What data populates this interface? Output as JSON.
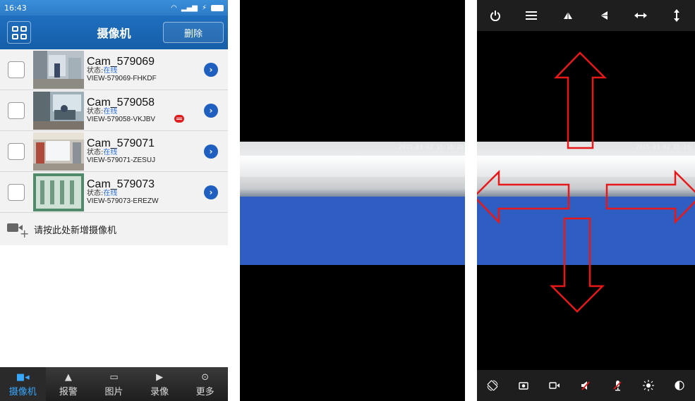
{
  "camera_list": {
    "status_bar": {
      "time": "16:43"
    },
    "header": {
      "title": "摄像机",
      "delete_label": "删除"
    },
    "cameras": [
      {
        "name": "Cam_579069",
        "status_label": "状态:",
        "status_value": "在线",
        "id": "VIEW-579069-FHKDF",
        "has_message": false
      },
      {
        "name": "Cam_579058",
        "status_label": "状态:",
        "status_value": "在线",
        "id": "VIEW-579058-VKJBV",
        "has_message": true
      },
      {
        "name": "Cam_579071",
        "status_label": "状态:",
        "status_value": "在线",
        "id": "VIEW-579071-ZESUJ",
        "has_message": false
      },
      {
        "name": "Cam_579073",
        "status_label": "状态:",
        "status_value": "在线",
        "id": "VIEW-579073-EREZW",
        "has_message": false
      }
    ],
    "add_camera_label": "请按此处新增摄像机",
    "tabs": [
      {
        "label": "摄像机",
        "icon": "camera-icon",
        "active": true
      },
      {
        "label": "报警",
        "icon": "bell-icon",
        "active": false
      },
      {
        "label": "图片",
        "icon": "picture-icon",
        "active": false
      },
      {
        "label": "录像",
        "icon": "video-icon",
        "active": false
      },
      {
        "label": "更多",
        "icon": "more-icon",
        "active": false
      }
    ]
  },
  "video_view": {
    "timestamp": "2015-03-02 15:16:20"
  },
  "ptz_view": {
    "timestamp": "2015-03-02 15:16:",
    "top_toolbar": [
      "power-icon",
      "menu-icon",
      "flip-vertical-icon",
      "mirror-icon",
      "pan-horizontal-icon",
      "tilt-vertical-icon"
    ],
    "bottom_toolbar": [
      "rotate-icon",
      "snapshot-icon",
      "record-icon",
      "speaker-mute-icon",
      "mic-mute-icon",
      "brightness-icon",
      "contrast-icon"
    ],
    "arrow_color": "#e81818"
  },
  "colors": {
    "header_blue": "#155ea8",
    "online_blue": "#2a6fd8",
    "active_tab": "#38a8ff"
  }
}
